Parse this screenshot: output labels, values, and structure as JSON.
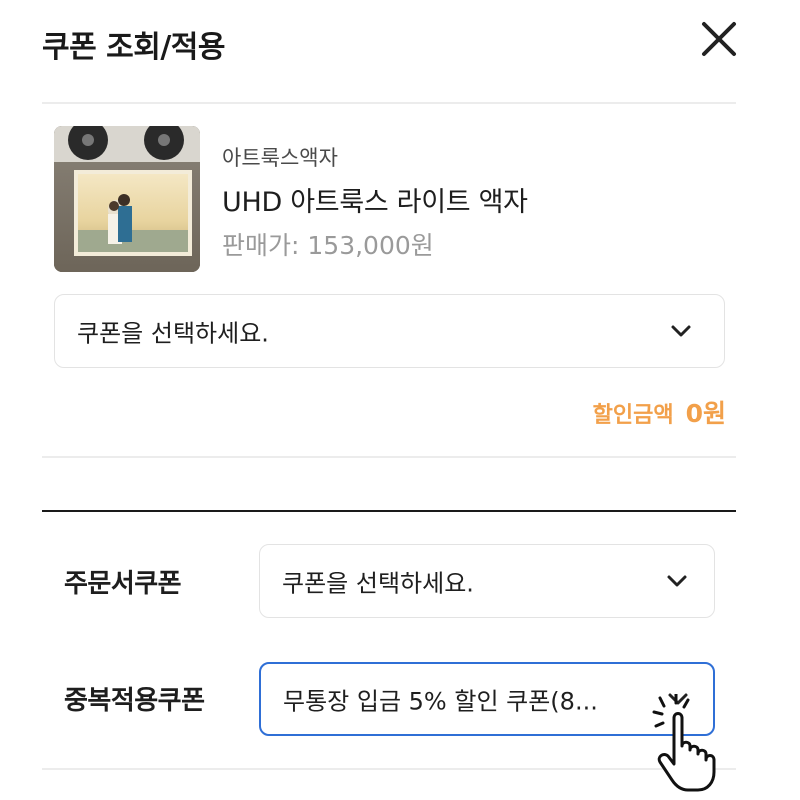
{
  "header": {
    "title": "쿠폰 조회/적용",
    "close_icon": "close-icon"
  },
  "product": {
    "brand": "아트룩스액자",
    "name": "UHD 아트룩스 라이트 액자",
    "price_label": "판매가:",
    "price_value": "153,000원"
  },
  "item_coupon": {
    "selected": "쿠폰을 선택하세요.",
    "icon": "chevron-down-icon"
  },
  "discount": {
    "label": "할인금액",
    "value": "0원",
    "color": "#f2a04a"
  },
  "order_coupon": {
    "label": "주문서쿠폰",
    "selected": "쿠폰을 선택하세요."
  },
  "duplicate_coupon": {
    "label": "중복적용쿠폰",
    "selected": "무통장 입금 5% 할인 쿠폰(8...",
    "accent": "#2f6fd6"
  },
  "pointer": {
    "icon": "hand-pointer-icon"
  }
}
